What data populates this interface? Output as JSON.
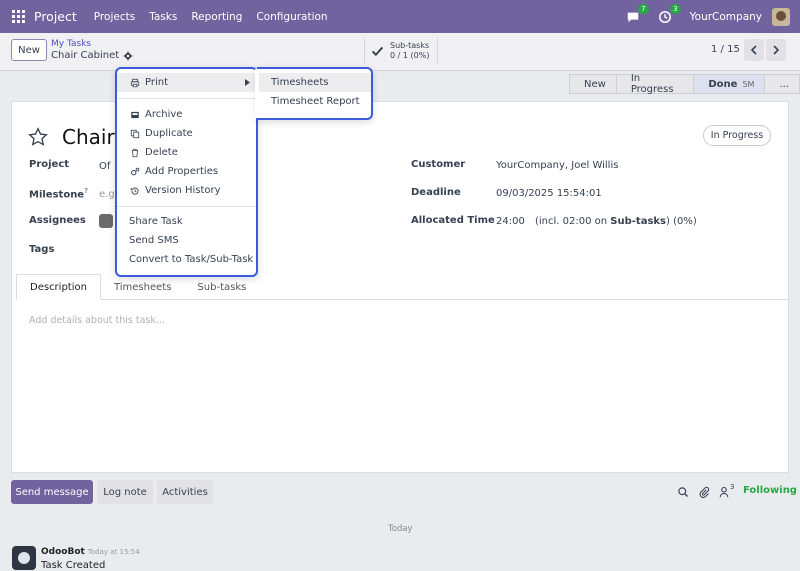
{
  "navbar": {
    "app_name": "Project",
    "menu": [
      "Projects",
      "Tasks",
      "Reporting",
      "Configuration"
    ],
    "messages_count": "7",
    "activities_count": "3",
    "company": "YourCompany"
  },
  "control": {
    "new_label": "New",
    "breadcrumb": "My Tasks",
    "record_name": "Chair Cabinet",
    "subtasks_label": "Sub-tasks",
    "subtasks_count": "0 / 1 (0%)",
    "pager": "1 / 15"
  },
  "statusbar": {
    "stages": [
      {
        "label": "New"
      },
      {
        "label": "In Progress"
      },
      {
        "label": "Done",
        "duration": "5M"
      },
      {
        "label": "..."
      }
    ]
  },
  "form": {
    "title": "Chair",
    "state_badge": "In Progress",
    "project_label": "Project",
    "project_value": "Of",
    "milestone_label": "Milestone",
    "milestone_help": "?",
    "milestone_placeholder": "e.g.",
    "assignees_label": "Assignees",
    "tags_label": "Tags",
    "customer_label": "Customer",
    "customer_value": "YourCompany, Joel Willis",
    "deadline_label": "Deadline",
    "deadline_value": "09/03/2025 15:54:01",
    "allocated_label": "Allocated Time",
    "allocated_value": "24:00",
    "allocated_note_prefix": "(incl. 02:00 on",
    "allocated_note_link": "Sub-tasks",
    "allocated_note_suffix": ") (0%)",
    "tabs": [
      "Description",
      "Timesheets",
      "Sub-tasks"
    ],
    "description_placeholder": "Add details about this task..."
  },
  "chatter": {
    "send_message": "Send message",
    "log_note": "Log note",
    "activities": "Activities",
    "followers_count": "3",
    "following": "Following",
    "date_separator": "Today",
    "message_author": "OdooBot",
    "message_time": "Today at 15:54",
    "message_body": "Task Created"
  },
  "gear_menu": {
    "print": "Print",
    "archive": "Archive",
    "duplicate": "Duplicate",
    "delete": "Delete",
    "add_properties": "Add Properties",
    "version_history": "Version History",
    "share_task": "Share Task",
    "send_sms": "Send SMS",
    "convert": "Convert to Task/Sub-Task"
  },
  "print_submenu": {
    "timesheets": "Timesheets",
    "timesheet_report": "Timesheet Report"
  },
  "colors": {
    "brand": "#71639e",
    "highlight_border": "#3b5bdb",
    "following": "#28a745"
  }
}
